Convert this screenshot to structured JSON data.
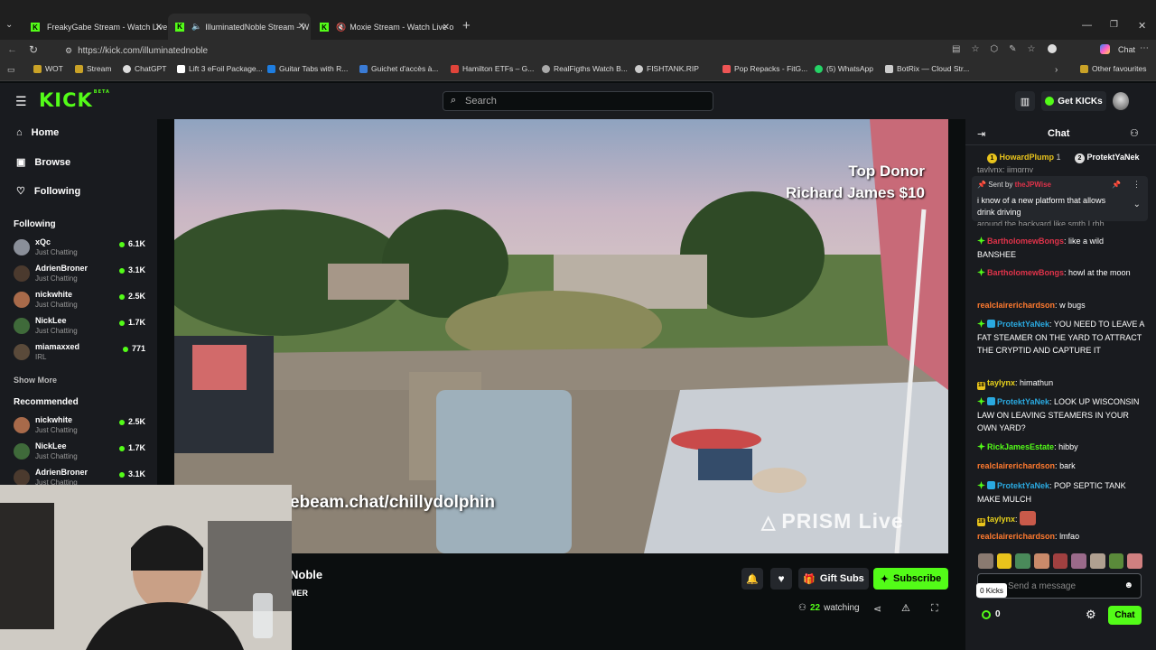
{
  "browser": {
    "tabs": [
      {
        "title": "FreakyGabe Stream - Watch Live o"
      },
      {
        "title": "IlluminatedNoble Stream - W"
      },
      {
        "title": "Moxie Stream - Watch Live o"
      }
    ],
    "url": "https://kick.com/illuminatednoble",
    "copilot_label": "Chat",
    "bookmarks": [
      "WOT",
      "Stream",
      "ChatGPT",
      "Lift 3 eFoil Package...",
      "Guitar Tabs with R...",
      "Guichet d'accès à...",
      "Hamilton ETFs – G...",
      "RealFigths Watch B...",
      "FISHTANK.RIP",
      "Pop Repacks - FitG...",
      "(5) WhatsApp",
      "BotRix — Cloud Str...",
      "Other favourites"
    ]
  },
  "header": {
    "logo": "KICK",
    "logo_beta": "BETA",
    "search_placeholder": "Search",
    "get_kicks": "Get KICKs"
  },
  "sidebar": {
    "nav": [
      {
        "label": "Home"
      },
      {
        "label": "Browse"
      },
      {
        "label": "Following"
      }
    ],
    "following_title": "Following",
    "following": [
      {
        "name": "xQc",
        "category": "Just Chatting",
        "viewers": "6.1K",
        "color": "#8a8f99"
      },
      {
        "name": "AdrienBroner",
        "category": "Just Chatting",
        "viewers": "3.1K",
        "color": "#4b3a2e"
      },
      {
        "name": "nickwhite",
        "category": "Just Chatting",
        "viewers": "2.5K",
        "color": "#a86a4a"
      },
      {
        "name": "NickLee",
        "category": "Just Chatting",
        "viewers": "1.7K",
        "color": "#3f6a3a"
      },
      {
        "name": "miamaxxed",
        "category": "IRL",
        "viewers": "771",
        "color": "#5a4a3a"
      }
    ],
    "show_more": "Show More",
    "recommended_title": "Recommended",
    "recommended": [
      {
        "name": "nickwhite",
        "category": "Just Chatting",
        "viewers": "2.5K",
        "color": "#a86a4a"
      },
      {
        "name": "NickLee",
        "category": "Just Chatting",
        "viewers": "1.7K",
        "color": "#3f6a3a"
      },
      {
        "name": "AdrienBroner",
        "category": "Just Chatting",
        "viewers": "3.1K",
        "color": "#4b3a2e"
      }
    ]
  },
  "video": {
    "overlay_top_donor": "Top Donor",
    "overlay_donor_amount": "Richard James $10",
    "overlay_url": "ebeam.chat/chillydolphin",
    "overlay_prism": "PRISM Live"
  },
  "stream": {
    "name_fragment": "Noble",
    "tag_fragment": "MER",
    "gift_subs": "Gift Subs",
    "subscribe": "Subscribe",
    "watching_count": "22",
    "watching_label": "watching"
  },
  "chat": {
    "title": "Chat",
    "top_gifters": [
      {
        "rank": "1",
        "name": "HowardPlump",
        "count": "1"
      },
      {
        "rank": "2",
        "name": "ProtektYaNek"
      }
    ],
    "partial_top": "taylynx: iimgrny",
    "pinned": {
      "sent_by": "Sent by",
      "author": "theJPWise",
      "text": "i know of a new platform that allows drink driving",
      "partial_below": "around the backyard like smth I rhh"
    },
    "messages": [
      {
        "user": "BartholomewBongs",
        "color": "#e0334a",
        "badges": [
          "g"
        ],
        "text": "like a wild BANSHEE"
      },
      {
        "user": "BartholomewBongs",
        "color": "#e0334a",
        "badges": [
          "g"
        ],
        "text": "howl at the moon"
      },
      {
        "user": "realclairerichardson",
        "color": "#ff7a2f",
        "badges": [],
        "text": "w bugs"
      },
      {
        "user": "ProtektYaNek",
        "color": "#2aa9e0",
        "badges": [
          "g",
          "b"
        ],
        "text": "YOU NEED TO LEAVE A FAT STEAMER ON THE YARD TO ATTRACT THE CRYPTID AND CAPTURE IT"
      },
      {
        "user": "taylynx",
        "color": "#e8d21c",
        "badges": [
          "y"
        ],
        "text": "himathun"
      },
      {
        "user": "ProtektYaNek",
        "color": "#2aa9e0",
        "badges": [
          "g",
          "b"
        ],
        "text": "LOOK UP WISCONSIN LAW ON LEAVING STEAMERS IN YOUR OWN YARD?"
      },
      {
        "user": "RickJamesEstate",
        "color": "#53fc18",
        "badges": [
          "g"
        ],
        "text": "hibby"
      },
      {
        "user": "realclairerichardson",
        "color": "#ff7a2f",
        "badges": [],
        "text": "bark"
      },
      {
        "user": "ProtektYaNek",
        "color": "#2aa9e0",
        "badges": [
          "g",
          "b"
        ],
        "text": "POP SEPTIC TANK MAKE MULCH"
      },
      {
        "user": "taylynx",
        "color": "#e8d21c",
        "badges": [
          "y"
        ],
        "text": ""
      },
      {
        "user": "realclairerichardson",
        "color": "#ff7a2f",
        "badges": [],
        "text": "lmfao"
      }
    ],
    "input_placeholder": "Send a message",
    "kicks_tooltip": "0 Kicks",
    "kicks_count": "0",
    "send_label": "Chat",
    "yellow_badge_number": "18"
  },
  "colors": {
    "accent": "#53fc18",
    "bg": "#0b0e0f",
    "panel": "#191b1f"
  }
}
